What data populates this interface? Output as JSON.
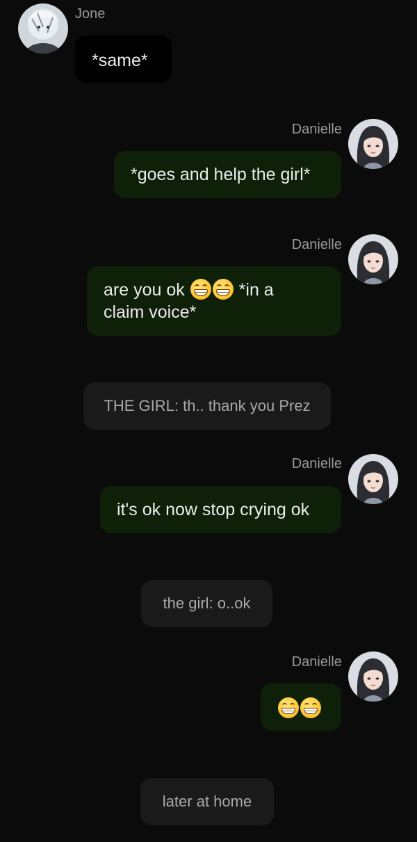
{
  "messages": [
    {
      "sender": "Jone",
      "text": "*same*"
    },
    {
      "sender": "Danielle",
      "text": "*goes and help the girl*"
    },
    {
      "sender": "Danielle",
      "text_before": "are you ok",
      "emoji": [
        "grinning-face-emoji",
        "grinning-face-emoji"
      ],
      "text_after": "*in a",
      "text_line2": "claim voice*"
    },
    {
      "narration": "THE GIRL: th.. thank you Prez"
    },
    {
      "sender": "Danielle",
      "text": "it's ok now stop crying ok"
    },
    {
      "narration": "the girl: o..ok"
    },
    {
      "sender": "Danielle",
      "emoji": [
        "grinning-face-emoji",
        "grinning-face-emoji"
      ]
    },
    {
      "narration": "later at home"
    }
  ],
  "colors": {
    "background": "#0b0b0b",
    "user_bubble": "#0e2008",
    "character_bubble": "#000000",
    "narration_bubble": "#1a1a1a",
    "name_text": "#9a9a9a"
  }
}
